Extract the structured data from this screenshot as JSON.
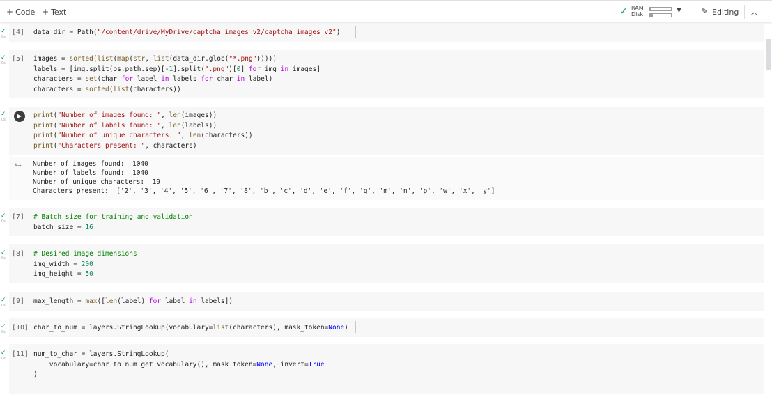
{
  "toolbar": {
    "add_code": "Code",
    "add_text": "Text",
    "ram_label": "RAM",
    "disk_label": "Disk",
    "ram_usage": 0.08,
    "disk_usage": 0.13,
    "editing_label": "Editing"
  },
  "icons": {
    "connected": "check-icon",
    "dropdown": "chevron-down-icon",
    "edit": "pencil-icon",
    "collapse": "chevron-up-icon",
    "run": "play-icon",
    "output": "output-arrow-icon"
  },
  "cells": [
    {
      "prompt": "[4]",
      "lines": [
        [
          {
            "t": "data_dir = Path("
          },
          {
            "t": "\"/content/drive/MyDrive/captcha_images_v2/captcha_images_v2\"",
            "c": "str"
          },
          {
            "t": ")"
          }
        ]
      ]
    },
    {
      "prompt": "[5]",
      "lines": [
        [
          {
            "t": "images = "
          },
          {
            "t": "sorted",
            "c": "fn"
          },
          {
            "t": "("
          },
          {
            "t": "list",
            "c": "fn"
          },
          {
            "t": "("
          },
          {
            "t": "map",
            "c": "fn"
          },
          {
            "t": "("
          },
          {
            "t": "str",
            "c": "fn"
          },
          {
            "t": ", "
          },
          {
            "t": "list",
            "c": "fn"
          },
          {
            "t": "(data_dir.glob("
          },
          {
            "t": "\"*.png\"",
            "c": "str"
          },
          {
            "t": ")))))"
          }
        ],
        [
          {
            "t": "labels = [img.split(os.path.sep)[-"
          },
          {
            "t": "1",
            "c": "num"
          },
          {
            "t": "].split("
          },
          {
            "t": "\".png\"",
            "c": "str"
          },
          {
            "t": ")["
          },
          {
            "t": "0",
            "c": "num"
          },
          {
            "t": "] "
          },
          {
            "t": "for",
            "c": "kw"
          },
          {
            "t": " img "
          },
          {
            "t": "in",
            "c": "kw"
          },
          {
            "t": " images]"
          }
        ],
        [
          {
            "t": "characters = "
          },
          {
            "t": "set",
            "c": "fn"
          },
          {
            "t": "(char "
          },
          {
            "t": "for",
            "c": "kw"
          },
          {
            "t": " label "
          },
          {
            "t": "in",
            "c": "kw"
          },
          {
            "t": " labels "
          },
          {
            "t": "for",
            "c": "kw"
          },
          {
            "t": " char "
          },
          {
            "t": "in",
            "c": "kw"
          },
          {
            "t": " label)"
          }
        ],
        [
          {
            "t": "characters = "
          },
          {
            "t": "sorted",
            "c": "fn"
          },
          {
            "t": "("
          },
          {
            "t": "list",
            "c": "fn"
          },
          {
            "t": "(characters))"
          }
        ]
      ]
    },
    {
      "prompt": "",
      "lines": [
        [
          {
            "t": "print",
            "c": "fn"
          },
          {
            "t": "("
          },
          {
            "t": "\"Number of images found: \"",
            "c": "str"
          },
          {
            "t": ", "
          },
          {
            "t": "len",
            "c": "fn"
          },
          {
            "t": "(images))"
          }
        ],
        [
          {
            "t": "print",
            "c": "fn"
          },
          {
            "t": "("
          },
          {
            "t": "\"Number of labels found: \"",
            "c": "str"
          },
          {
            "t": ", "
          },
          {
            "t": "len",
            "c": "fn"
          },
          {
            "t": "(labels))"
          }
        ],
        [
          {
            "t": "print",
            "c": "fn"
          },
          {
            "t": "("
          },
          {
            "t": "\"Number of unique characters: \"",
            "c": "str"
          },
          {
            "t": ", "
          },
          {
            "t": "len",
            "c": "fn"
          },
          {
            "t": "(characters))"
          }
        ],
        [
          {
            "t": "print",
            "c": "fn"
          },
          {
            "t": "("
          },
          {
            "t": "\"Characters present: \"",
            "c": "str"
          },
          {
            "t": ", characters)"
          }
        ]
      ],
      "output": [
        "Number of images found:  1040",
        "Number of labels found:  1040",
        "Number of unique characters:  19",
        "Characters present:  ['2', '3', '4', '5', '6', '7', '8', 'b', 'c', 'd', 'e', 'f', 'g', 'm', 'n', 'p', 'w', 'x', 'y']"
      ]
    },
    {
      "prompt": "[7]",
      "lines": [
        [
          {
            "t": "# Batch size for training and validation",
            "c": "com"
          }
        ],
        [
          {
            "t": "batch_size = "
          },
          {
            "t": "16",
            "c": "num"
          }
        ]
      ]
    },
    {
      "prompt": "[8]",
      "lines": [
        [
          {
            "t": "# Desired image dimensions",
            "c": "com"
          }
        ],
        [
          {
            "t": "img_width = "
          },
          {
            "t": "200",
            "c": "num"
          }
        ],
        [
          {
            "t": "img_height = "
          },
          {
            "t": "50",
            "c": "num"
          }
        ]
      ]
    },
    {
      "prompt": "[9]",
      "lines": [
        [
          {
            "t": "max_length = "
          },
          {
            "t": "max",
            "c": "fn"
          },
          {
            "t": "(["
          },
          {
            "t": "len",
            "c": "fn"
          },
          {
            "t": "(label) "
          },
          {
            "t": "for",
            "c": "kw"
          },
          {
            "t": " label "
          },
          {
            "t": "in",
            "c": "kw"
          },
          {
            "t": " labels])"
          }
        ]
      ]
    },
    {
      "prompt": "[10]",
      "lines": [
        [
          {
            "t": "char_to_num = layers.StringLookup(vocabulary="
          },
          {
            "t": "list",
            "c": "fn"
          },
          {
            "t": "(characters), mask_token="
          },
          {
            "t": "None",
            "c": "bi"
          },
          {
            "t": ")"
          }
        ]
      ]
    },
    {
      "prompt": "[11]",
      "lines": [
        [
          {
            "t": "num_to_char = layers.StringLookup("
          }
        ],
        [
          {
            "t": "    vocabulary=char_to_num.get_vocabulary(), mask_token="
          },
          {
            "t": "None",
            "c": "bi"
          },
          {
            "t": ", invert="
          },
          {
            "t": "True",
            "c": "bi"
          }
        ],
        [
          {
            "t": ")"
          }
        ]
      ]
    }
  ],
  "status": {
    "check": "✓",
    "seconds": "0s"
  }
}
